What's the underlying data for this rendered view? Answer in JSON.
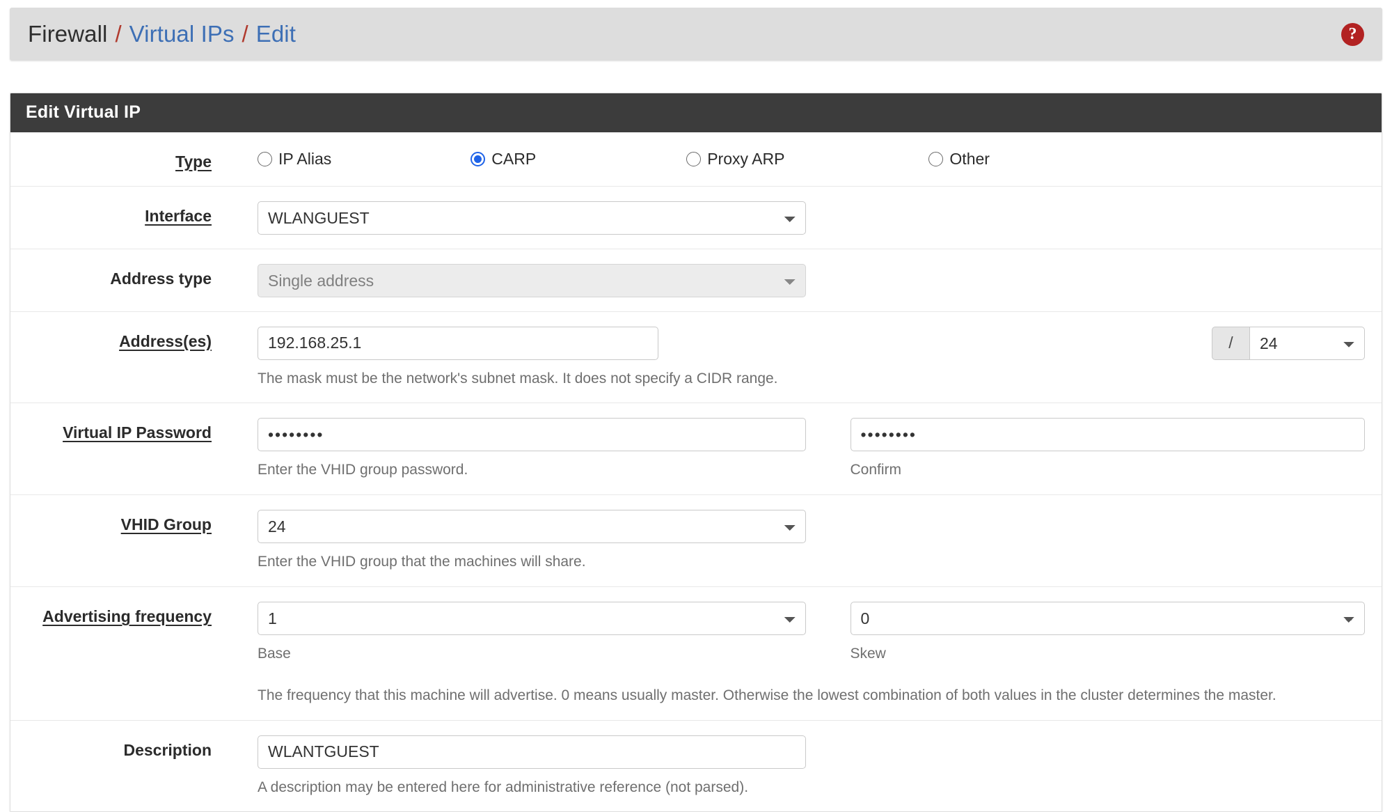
{
  "breadcrumb": {
    "items": [
      {
        "text": "Firewall",
        "link": false
      },
      {
        "text": "Virtual IPs",
        "link": true
      },
      {
        "text": "Edit",
        "link": true
      }
    ],
    "separator": "/",
    "help_icon": "?",
    "help_icon_name": "help-circle-icon"
  },
  "panel": {
    "title": "Edit Virtual IP"
  },
  "form": {
    "type": {
      "label": "Type",
      "options": [
        {
          "label": "IP Alias",
          "checked": false
        },
        {
          "label": "CARP",
          "checked": true
        },
        {
          "label": "Proxy ARP",
          "checked": false
        },
        {
          "label": "Other",
          "checked": false
        }
      ]
    },
    "interface": {
      "label": "Interface",
      "value": "WLANGUEST"
    },
    "address_type": {
      "label": "Address type",
      "value": "Single address",
      "disabled": true
    },
    "addresses": {
      "label": "Address(es)",
      "value": "192.168.25.1",
      "cidr_prefix": "/",
      "cidr_value": "24",
      "help": "The mask must be the network's subnet mask. It does not specify a CIDR range."
    },
    "vip_password": {
      "label": "Virtual IP Password",
      "value": "••••••••",
      "help": "Enter the VHID group password.",
      "confirm_value": "••••••••",
      "confirm_help": "Confirm"
    },
    "vhid_group": {
      "label": "VHID Group",
      "value": "24",
      "help": "Enter the VHID group that the machines will share."
    },
    "advertising_frequency": {
      "label": "Advertising frequency",
      "base_value": "1",
      "base_help": "Base",
      "skew_value": "0",
      "skew_help": "Skew",
      "help": "The frequency that this machine will advertise. 0 means usually master. Otherwise the lowest combination of both values in the cluster determines the master."
    },
    "description": {
      "label": "Description",
      "value": "WLANTGUEST",
      "help": "A description may be entered here for administrative reference (not parsed)."
    }
  },
  "colors": {
    "accent_blue": "#3d6fb5",
    "separator_red": "#b03a2e",
    "help_red": "#b22222",
    "panel_header": "#3c3c3c",
    "radio_selected": "#1f63e8"
  }
}
